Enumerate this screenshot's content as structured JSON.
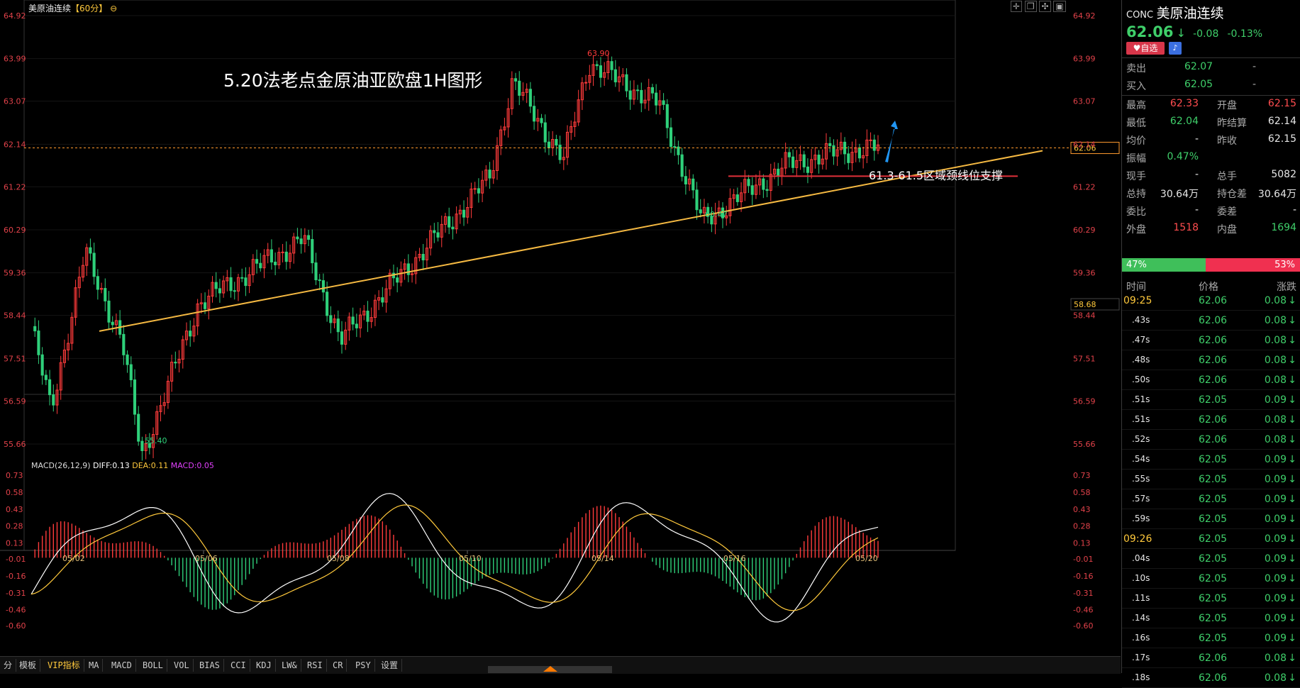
{
  "header": {
    "symbol_name": "美原油连续",
    "period_bracket": "【60分】",
    "code": "CONC",
    "title": "美原油连续",
    "price": "62.06",
    "price_arrow": "↓",
    "change": "-0.08",
    "change_pct": "-0.13%",
    "fav_label": "自选"
  },
  "annotation": {
    "title": "5.20法老点金原油亚欧盘1H图形",
    "support_note": "61.3-61.5区域颈线位支撑"
  },
  "colors": {
    "up": "#ff3b3b",
    "down": "#2fd07a",
    "yellow": "#ffc93c",
    "white": "#ffffff",
    "magenta": "#e040fb",
    "trend": "#f5b942"
  },
  "price_axis": {
    "ticks": [
      "64.92",
      "63.99",
      "63.07",
      "62.14",
      "61.22",
      "60.29",
      "59.36",
      "58.44",
      "57.51",
      "56.59",
      "55.66"
    ],
    "current": "62.06",
    "marker": "58.68"
  },
  "macd": {
    "label": "MACD(26,12,9)",
    "diff_label": "DIFF:0.13",
    "dea_label": "DEA:0.11",
    "macd_label": "MACD:0.05",
    "ticks": [
      "0.73",
      "0.58",
      "0.43",
      "0.28",
      "0.13",
      "-0.01",
      "-0.16",
      "-0.31",
      "-0.46",
      "-0.60"
    ]
  },
  "x_axis": {
    "dates": [
      "05/02",
      "05/06",
      "05/08",
      "05/10",
      "05/14",
      "05/16",
      "05/20"
    ]
  },
  "chart_data": {
    "type": "candlestick",
    "title": "5.20法老点金原油亚欧盘1H图形",
    "x_dates": [
      "05/02",
      "05/06",
      "05/08",
      "05/10",
      "05/14",
      "05/16",
      "05/20"
    ],
    "ylim": [
      55.3,
      65.0
    ],
    "price_labels": {
      "high": "63.90",
      "low": "55.40",
      "swing_low": "60.47"
    },
    "last_price": 62.06,
    "key_points": [
      {
        "date": "05/01",
        "price": 58.2
      },
      {
        "date": "05/02",
        "price": 56.4
      },
      {
        "date": "05/02",
        "price": 59.8
      },
      {
        "date": "05/03",
        "price": 57.9
      },
      {
        "date": "05/06",
        "price": 55.4
      },
      {
        "date": "05/07",
        "price": 58.7
      },
      {
        "date": "05/07",
        "price": 60.1
      },
      {
        "date": "05/08",
        "price": 57.9
      },
      {
        "date": "05/10",
        "price": 61.4
      },
      {
        "date": "05/10",
        "price": 63.5
      },
      {
        "date": "05/13",
        "price": 61.8
      },
      {
        "date": "05/14",
        "price": 63.9
      },
      {
        "date": "05/15",
        "price": 63.0
      },
      {
        "date": "05/15",
        "price": 60.47
      },
      {
        "date": "05/17",
        "price": 61.7
      },
      {
        "date": "05/17",
        "price": 62.0
      },
      {
        "date": "05/20",
        "price": 62.06
      }
    ],
    "macd_series": [
      {
        "name": "DIFF",
        "last": 0.13
      },
      {
        "name": "DEA",
        "last": 0.11
      },
      {
        "name": "MACD",
        "last": 0.05
      }
    ]
  },
  "quote": {
    "sell_label": "卖出",
    "sell": "62.07",
    "sell_vol": "-",
    "buy_label": "买入",
    "buy": "62.05",
    "buy_vol": "-",
    "rows": [
      {
        "l1": "最高",
        "v1": "62.33",
        "c1": "red",
        "l2": "开盘",
        "v2": "62.15",
        "c2": "red"
      },
      {
        "l1": "最低",
        "v1": "62.04",
        "c1": "green",
        "l2": "昨结算",
        "v2": "62.14",
        "c2": "white"
      },
      {
        "l1": "均价",
        "v1": "-",
        "c1": "white",
        "l2": "昨收",
        "v2": "62.15",
        "c2": "white"
      },
      {
        "l1": "振幅",
        "v1": "0.47%",
        "c1": "green",
        "l2": "",
        "v2": "",
        "c2": "white"
      },
      {
        "l1": "现手",
        "v1": "-",
        "c1": "white",
        "l2": "总手",
        "v2": "5082",
        "c2": "white"
      },
      {
        "l1": "总持",
        "v1": "30.64万",
        "c1": "white",
        "l2": "持仓差",
        "v2": "30.64万",
        "c2": "white"
      },
      {
        "l1": "委比",
        "v1": "-",
        "c1": "white",
        "l2": "委差",
        "v2": "-",
        "c2": "white"
      },
      {
        "l1": "外盘",
        "v1": "1518",
        "c1": "red",
        "l2": "内盘",
        "v2": "1694",
        "c2": "green"
      }
    ],
    "buy_pct": "47%",
    "sell_pct": "53%",
    "buy_ratio": 0.47
  },
  "ticks_table": {
    "headers": [
      "时间",
      "价格",
      "涨跌"
    ],
    "rows": [
      {
        "t": "09:25",
        "p": "62.06",
        "c": "0.08",
        "hl": true
      },
      {
        "t": ".43s",
        "p": "62.06",
        "c": "0.08"
      },
      {
        "t": ".47s",
        "p": "62.06",
        "c": "0.08"
      },
      {
        "t": ".48s",
        "p": "62.06",
        "c": "0.08"
      },
      {
        "t": ".50s",
        "p": "62.06",
        "c": "0.08"
      },
      {
        "t": ".51s",
        "p": "62.05",
        "c": "0.09"
      },
      {
        "t": ".51s",
        "p": "62.06",
        "c": "0.08"
      },
      {
        "t": ".52s",
        "p": "62.06",
        "c": "0.08"
      },
      {
        "t": ".54s",
        "p": "62.05",
        "c": "0.09"
      },
      {
        "t": ".55s",
        "p": "62.05",
        "c": "0.09"
      },
      {
        "t": ".57s",
        "p": "62.05",
        "c": "0.09"
      },
      {
        "t": ".59s",
        "p": "62.05",
        "c": "0.09"
      },
      {
        "t": "09:26",
        "p": "62.05",
        "c": "0.09",
        "hl": true
      },
      {
        "t": ".04s",
        "p": "62.05",
        "c": "0.09"
      },
      {
        "t": ".10s",
        "p": "62.05",
        "c": "0.09"
      },
      {
        "t": ".11s",
        "p": "62.05",
        "c": "0.09"
      },
      {
        "t": ".14s",
        "p": "62.05",
        "c": "0.09"
      },
      {
        "t": ".16s",
        "p": "62.05",
        "c": "0.09"
      },
      {
        "t": ".17s",
        "p": "62.06",
        "c": "0.08"
      },
      {
        "t": ".18s",
        "p": "62.06",
        "c": "0.08"
      }
    ]
  },
  "bottom_tabs": [
    "分",
    "模板",
    "VIP指标",
    "MA",
    "MACD",
    "BOLL",
    "VOL",
    "BIAS",
    "CCI",
    "KDJ",
    "LW&",
    "RSI",
    "CR",
    "PSY",
    "设置"
  ]
}
